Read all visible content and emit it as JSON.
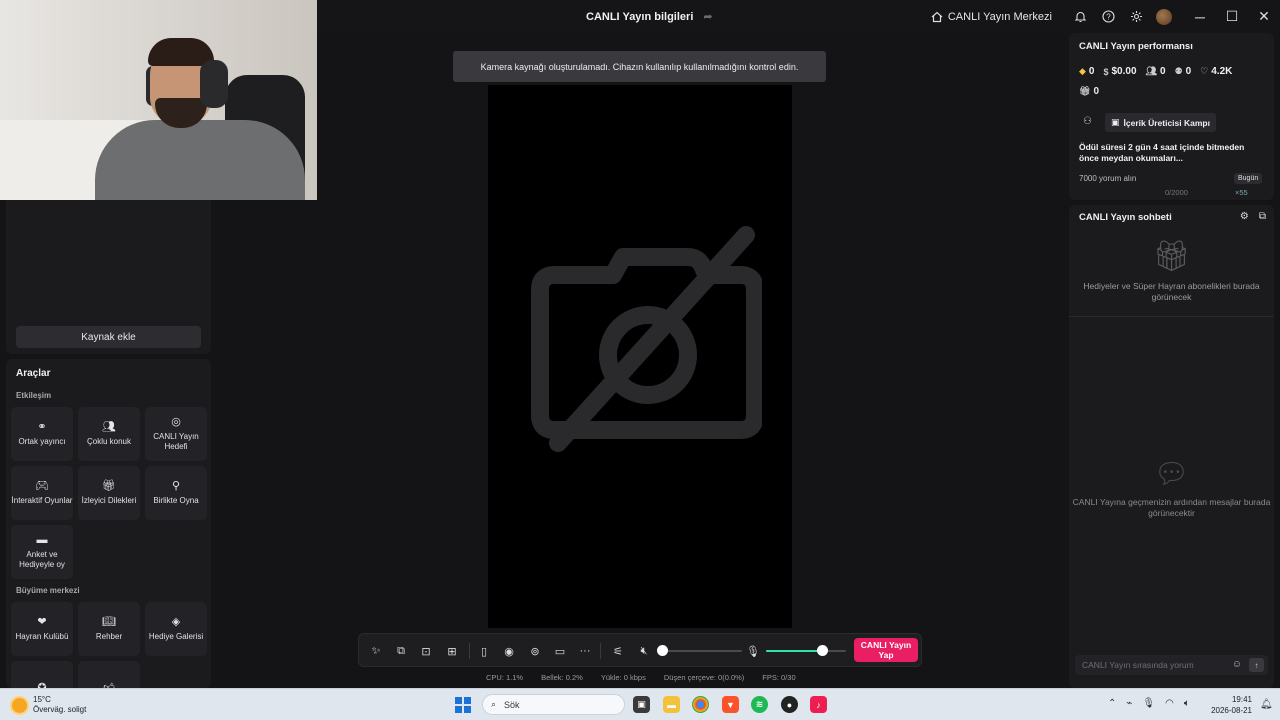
{
  "titlebar": {
    "title": "CANLI Yayın bilgileri",
    "live_center": "CANLI Yayın Merkezi"
  },
  "toast": {
    "message": "Kamera kaynağı oluşturulamadı. Cihazın kullanılıp kullanılmadığını kontrol edin."
  },
  "left": {
    "add_source": "Kaynak ekle",
    "tools_title": "Araçlar",
    "engagement_label": "Etkileşim",
    "engagement_tiles": [
      {
        "icon": "link-icon",
        "label": "Ortak yayıncı"
      },
      {
        "icon": "users-icon",
        "label": "Çoklu konuk"
      },
      {
        "icon": "target-icon",
        "label": "CANLI Yayın Hedefi"
      },
      {
        "icon": "gamepad-icon",
        "label": "İnteraktif Oyunlar"
      },
      {
        "icon": "gift-icon",
        "label": "İzleyici Dilekleri"
      },
      {
        "icon": "joystick-icon",
        "label": "Birlikte Oyna"
      },
      {
        "icon": "poll-icon",
        "label": "Anket ve Hediyeyle oy"
      }
    ],
    "growth_label": "Büyüme merkezi",
    "growth_tiles": [
      {
        "icon": "heart-icon",
        "label": "Hayran Kulübü"
      },
      {
        "icon": "book-icon",
        "label": "Rehber"
      },
      {
        "icon": "diamond-icon",
        "label": "Hediye Galerisi"
      }
    ]
  },
  "stats": {
    "cpu": "CPU:  1.1%",
    "memory": "Bellek:  0.2%",
    "upload": "Yükle:  0 kbps",
    "dropped": "Düşen çerçeve:  0(0.0%)",
    "fps": "FPS:  0/30"
  },
  "toolbar": {
    "go_live": "CANLI Yayın Yap",
    "volume_level": 0.0,
    "mic_level": 0.7
  },
  "performance": {
    "title": "CANLI Yayın performansı",
    "diamonds": "0",
    "earnings": "$0.00",
    "viewers": "0",
    "followers": "0",
    "likes": "4.2K",
    "gifts": "0",
    "campaign": "İçerik Üreticisi Kampı",
    "reward": "Ödül süresi 2 gün 4 saat içinde bitmeden önce meydan okumaları...",
    "task": "7000 yorum alın",
    "today": "Bugün",
    "progress": "0/2000",
    "gift_count": "×55"
  },
  "chat": {
    "title": "CANLI Yayın sohbeti",
    "gifts_empty": "Hediyeler ve Süper Hayran abonelikleri burada görünecek",
    "messages_empty": "CANLI Yayına geçmenizin ardından mesajlar burada görünecektir",
    "input_placeholder": "CANLI Yayın sırasında yorum"
  },
  "taskbar": {
    "temp": "15°C",
    "weather": "Överväg. soligt",
    "search": "Sök",
    "time": "19:41",
    "date": "2026-08-21"
  },
  "colors": {
    "accent": "#ea1e63",
    "mic_level": "#2ee6a6",
    "panel": "#1b1b1e",
    "background": "#141416"
  }
}
